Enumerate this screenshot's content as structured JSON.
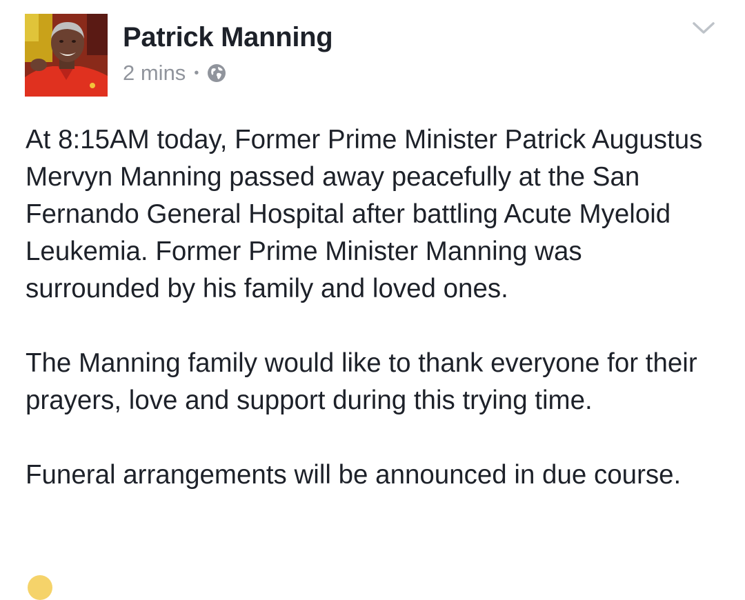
{
  "post": {
    "author_name": "Patrick Manning",
    "timestamp": "2 mins",
    "separator": "•",
    "privacy_icon": "globe-icon",
    "menu_icon": "chevron-down-icon",
    "paragraphs": [
      "At 8:15AM today, Former Prime Minister Patrick Augustus Mervyn Manning passed away peacefully at the San Fernando General Hospital after battling Acute Myeloid Leukemia. Former Prime Minister Manning was surrounded by his family and loved ones.",
      "The Manning family would like to thank everyone for their prayers, love and support during this trying time.",
      "Funeral arrangements will be announced in due course."
    ]
  },
  "colors": {
    "text_primary": "#1d2129",
    "text_secondary": "#90949c",
    "chevron": "#bec3c9"
  }
}
